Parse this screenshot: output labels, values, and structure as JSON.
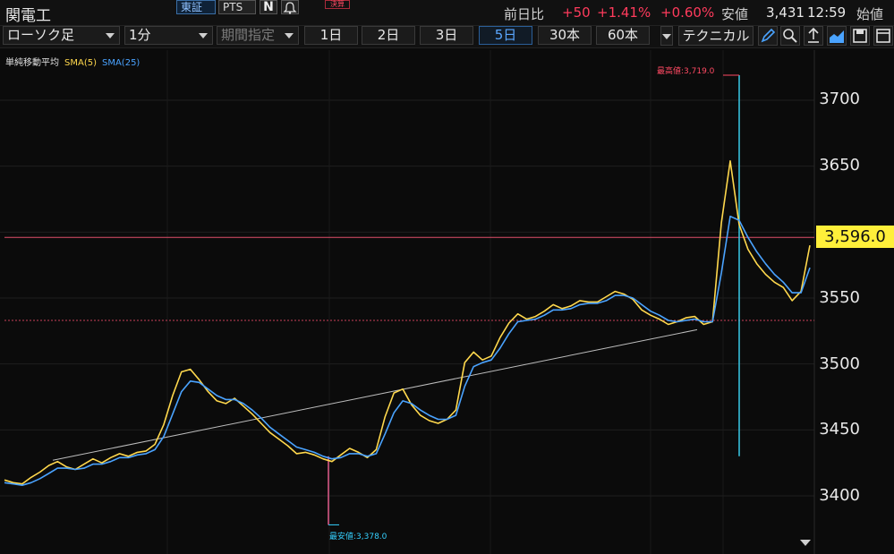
{
  "ticker": {
    "name": "関電工",
    "exchange": "東証",
    "pts": "PTS",
    "n_label": "N",
    "badge": "決算"
  },
  "quote": {
    "prev_label": "前日比",
    "change": "+50",
    "change_pct": "+1.41%",
    "pct2": "+0.60%",
    "low_label": "安値",
    "low_value": "3,431",
    "time": "12:59",
    "open_label": "始値"
  },
  "toolbar": {
    "chart_type": "ローソク足",
    "interval": "1分",
    "period": "期間指定",
    "ranges": [
      "1日",
      "2日",
      "3日",
      "5日",
      "30本",
      "60本"
    ],
    "active_range": "5日",
    "technical": "テクニカル"
  },
  "legend": {
    "title": "単純移動平均",
    "sma5": "SMA(5)",
    "sma25": "SMA(25)"
  },
  "chart_data": {
    "type": "line",
    "yticks": [
      3400,
      3450,
      3500,
      3550,
      3600,
      3650,
      3700
    ],
    "y_tick_labels": [
      "3400",
      "3450",
      "3500",
      "3550",
      "3650",
      "3700"
    ],
    "ylim": [
      3360,
      3730
    ],
    "current_price": 3596.0,
    "current_price_label": "3,596.0",
    "high": {
      "value": 3719.0,
      "label": "最高値:3,719.0"
    },
    "low": {
      "value": 3378.0,
      "label": "最安値:3,378.0"
    },
    "prev_close_line": 3533,
    "trendline": [
      [
        0.06,
        3427
      ],
      [
        0.86,
        3526
      ]
    ],
    "series": [
      {
        "name": "SMA(5)",
        "color": "#ffd84d",
        "values": [
          3412,
          3410,
          3409,
          3414,
          3418,
          3423,
          3426,
          3422,
          3420,
          3424,
          3428,
          3425,
          3429,
          3432,
          3430,
          3433,
          3434,
          3439,
          3454,
          3476,
          3494,
          3496,
          3488,
          3479,
          3472,
          3470,
          3474,
          3468,
          3462,
          3455,
          3448,
          3443,
          3438,
          3432,
          3433,
          3431,
          3428,
          3426,
          3431,
          3436,
          3433,
          3429,
          3435,
          3460,
          3478,
          3481,
          3469,
          3461,
          3457,
          3455,
          3458,
          3465,
          3501,
          3509,
          3503,
          3506,
          3520,
          3531,
          3538,
          3534,
          3536,
          3540,
          3545,
          3542,
          3544,
          3548,
          3547,
          3547,
          3551,
          3555,
          3553,
          3549,
          3541,
          3537,
          3534,
          3530,
          3532,
          3535,
          3536,
          3530,
          3532,
          3607,
          3654,
          3606,
          3587,
          3576,
          3568,
          3562,
          3558,
          3548,
          3555,
          3590
        ]
      },
      {
        "name": "SMA(25)",
        "color": "#4aa3ff",
        "values": [
          3410,
          3409,
          3408,
          3410,
          3413,
          3417,
          3421,
          3421,
          3420,
          3421,
          3424,
          3424,
          3426,
          3429,
          3429,
          3431,
          3432,
          3435,
          3445,
          3462,
          3479,
          3487,
          3486,
          3481,
          3476,
          3473,
          3473,
          3470,
          3465,
          3459,
          3452,
          3447,
          3442,
          3437,
          3435,
          3433,
          3430,
          3428,
          3429,
          3432,
          3432,
          3430,
          3432,
          3447,
          3463,
          3472,
          3470,
          3465,
          3461,
          3458,
          3458,
          3461,
          3483,
          3498,
          3501,
          3503,
          3512,
          3523,
          3532,
          3533,
          3534,
          3537,
          3541,
          3541,
          3542,
          3545,
          3546,
          3546,
          3548,
          3552,
          3552,
          3550,
          3545,
          3540,
          3537,
          3533,
          3532,
          3533,
          3534,
          3532,
          3532,
          3569,
          3612,
          3609,
          3596,
          3585,
          3576,
          3568,
          3562,
          3554,
          3554,
          3573
        ]
      }
    ]
  }
}
